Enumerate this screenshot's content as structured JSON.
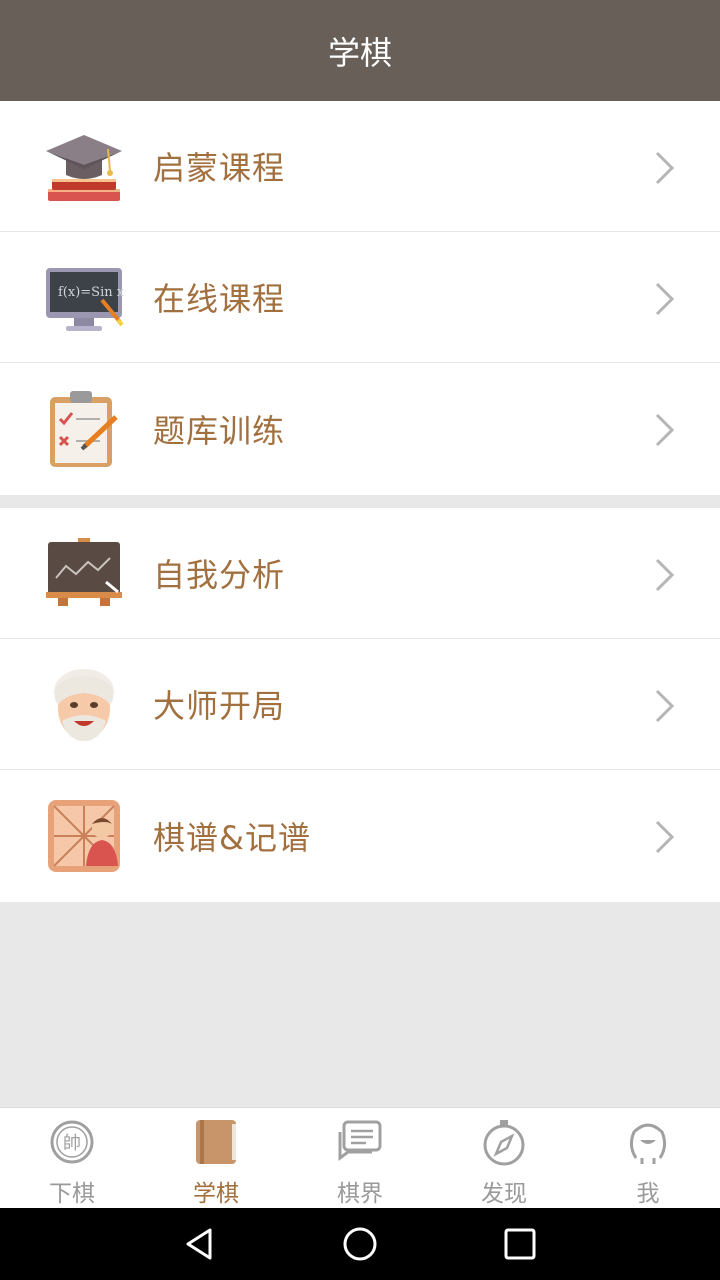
{
  "header": {
    "title": "学棋"
  },
  "groups": [
    {
      "items": [
        {
          "label": "启蒙课程",
          "icon": "graduation-cap-icon"
        },
        {
          "label": "在线课程",
          "icon": "computer-icon"
        },
        {
          "label": "题库训练",
          "icon": "clipboard-icon"
        }
      ]
    },
    {
      "items": [
        {
          "label": "自我分析",
          "icon": "chart-board-icon"
        },
        {
          "label": "大师开局",
          "icon": "master-face-icon"
        },
        {
          "label": "棋谱&记谱",
          "icon": "chessboard-person-icon"
        }
      ]
    }
  ],
  "tabbar": {
    "tabs": [
      {
        "label": "下棋",
        "icon": "shuai-piece-icon",
        "active": false
      },
      {
        "label": "学棋",
        "icon": "book-icon",
        "active": true
      },
      {
        "label": "棋界",
        "icon": "chat-icon",
        "active": false
      },
      {
        "label": "发现",
        "icon": "compass-icon",
        "active": false
      },
      {
        "label": "我",
        "icon": "profile-icon",
        "active": false
      }
    ]
  },
  "colors": {
    "header_bg": "#675f58",
    "accent": "#a2703f",
    "inactive": "#9a9a9a"
  }
}
